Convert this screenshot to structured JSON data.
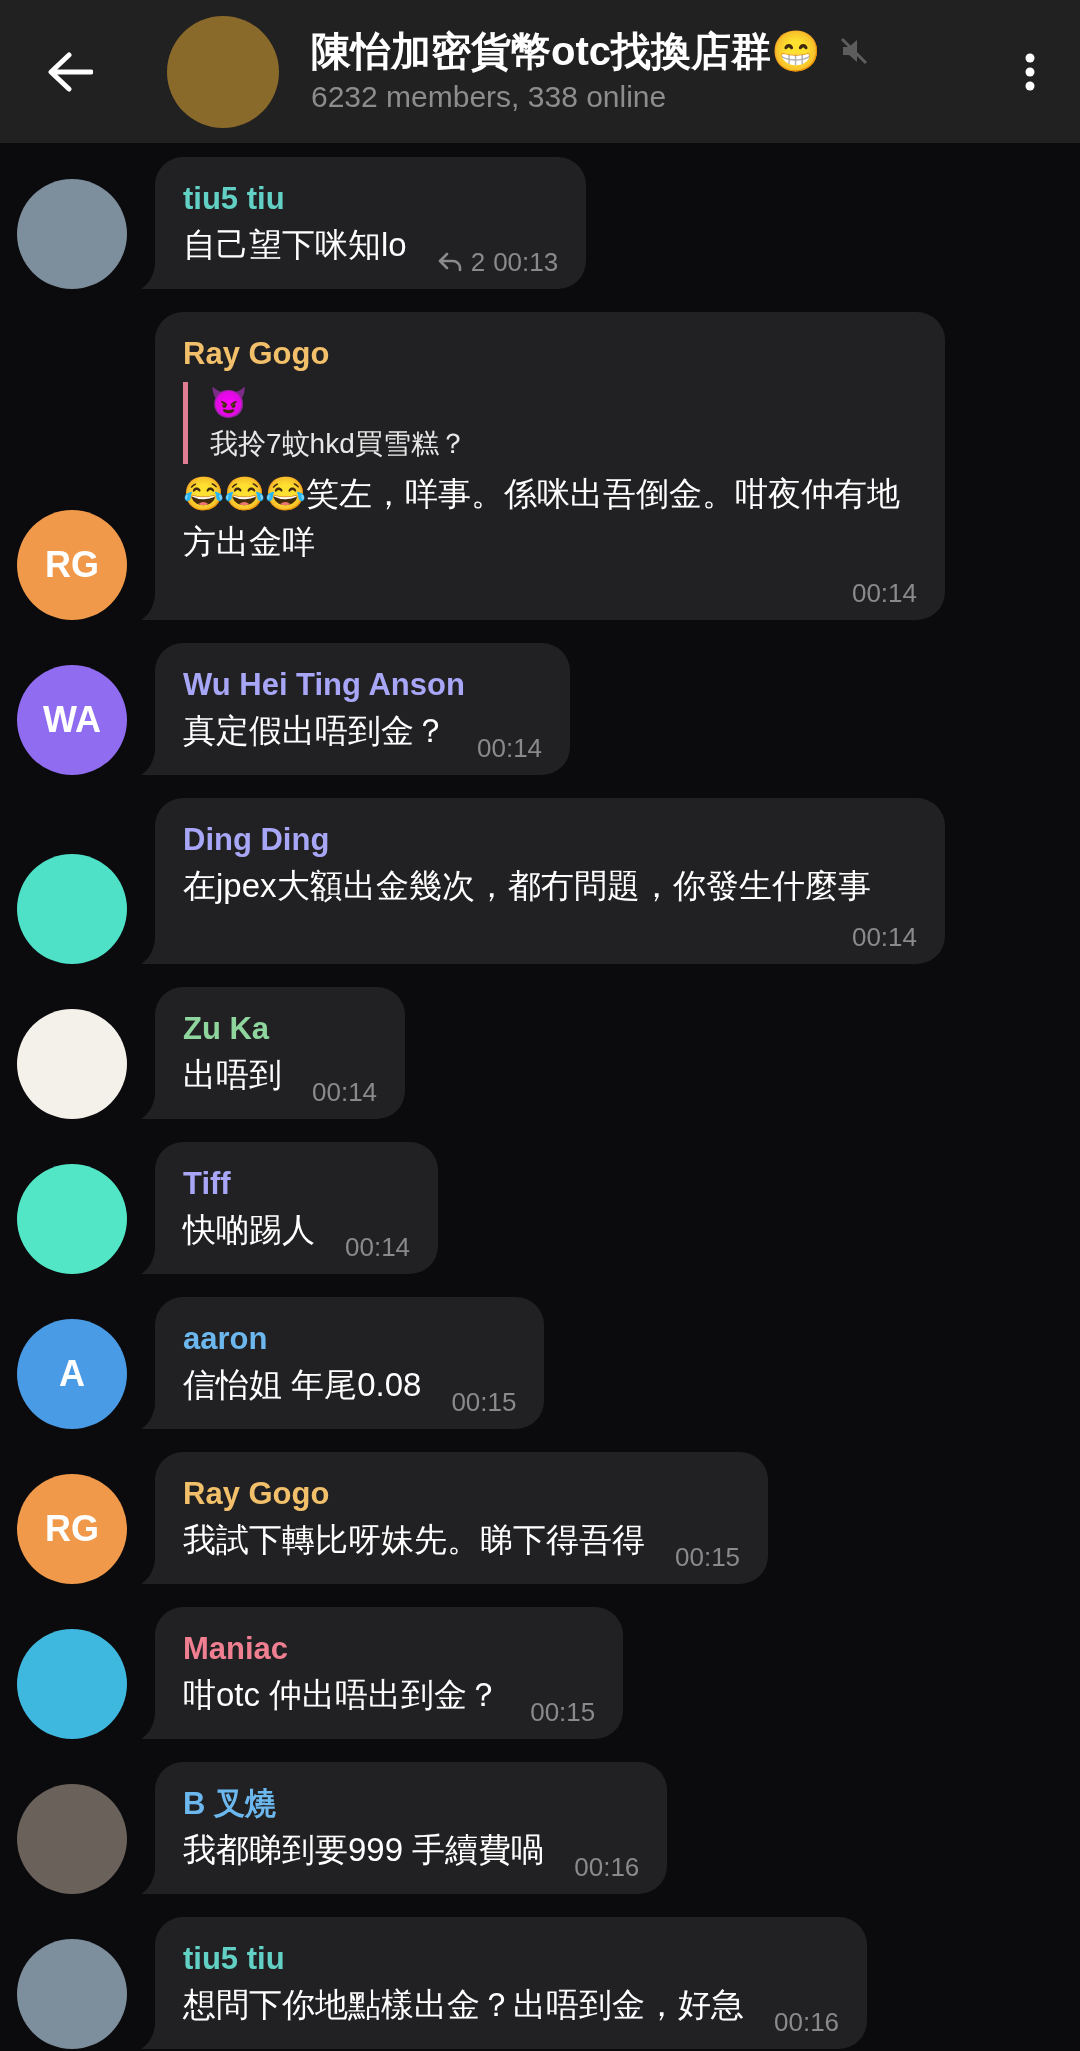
{
  "header": {
    "title": "陳怡加密貨幣otc找換店群😁",
    "subtitle": "6232 members, 338 online",
    "muted": true,
    "avatar": {
      "color": "#8a6a2a"
    }
  },
  "messages": [
    {
      "sender": "tiu5 tiu",
      "color": "#62d0c4",
      "avatar": {
        "kind": "image",
        "color": "#7d8f9c"
      },
      "text": "自己望下咪知lo",
      "replies": "2",
      "time": "00:13"
    },
    {
      "sender": "Ray Gogo",
      "color": "#f2c06a",
      "avatar": {
        "kind": "initials",
        "text": "RG",
        "color": "#f0994a"
      },
      "quote": {
        "title": "😈",
        "text": "我拎7蚊hkd買雪糕？",
        "color": "#e07d93"
      },
      "text": "😂😂😂笑左，咩事。係咪出吾倒金。咁夜仲有地方出金咩",
      "time": "00:14"
    },
    {
      "sender": "Wu Hei Ting Anson",
      "color": "#a8a6f6",
      "avatar": {
        "kind": "initials",
        "text": "WA",
        "color": "#8f6cf0"
      },
      "text": "真定假出唔到金？",
      "time": "00:14"
    },
    {
      "sender": "Ding Ding",
      "color": "#a8a6f6",
      "avatar": {
        "kind": "image",
        "color": "#4fe0c8"
      },
      "text": "在jpex大額出金幾次，都冇問題，你發生什麼事",
      "time": "00:14"
    },
    {
      "sender": "Zu Ka",
      "color": "#8fd59e",
      "avatar": {
        "kind": "image",
        "color": "#f3f1ea"
      },
      "text": "出唔到",
      "time": "00:14"
    },
    {
      "sender": "Tiff",
      "color": "#a8a6f6",
      "avatar": {
        "kind": "image",
        "color": "#52e6c6"
      },
      "text": "快啲踢人",
      "time": "00:14"
    },
    {
      "sender": "aaron",
      "color": "#6cb8ee",
      "avatar": {
        "kind": "initials",
        "text": "A",
        "color": "#4a9be6"
      },
      "text": "信怡姐 年尾0.08",
      "time": "00:15"
    },
    {
      "sender": "Ray Gogo",
      "color": "#f2c06a",
      "avatar": {
        "kind": "initials",
        "text": "RG",
        "color": "#f0994a"
      },
      "text": "我試下轉比呀妹先。睇下得吾得",
      "time": "00:15"
    },
    {
      "sender": "Maniac",
      "color": "#f07f91",
      "avatar": {
        "kind": "image",
        "color": "#3fb8e0"
      },
      "text": "咁otc 仲出唔出到金？",
      "time": "00:15"
    },
    {
      "sender": "B 叉燒",
      "color": "#6cb8ee",
      "avatar": {
        "kind": "image",
        "color": "#6a625a"
      },
      "text": "我都睇到要999 手續費喎",
      "time": "00:16"
    },
    {
      "sender": "tiu5 tiu",
      "color": "#62d0c4",
      "avatar": {
        "kind": "image",
        "color": "#7d8f9c"
      },
      "text": "想問下你地點樣出金？出唔到金，好急",
      "time": "00:16"
    }
  ]
}
